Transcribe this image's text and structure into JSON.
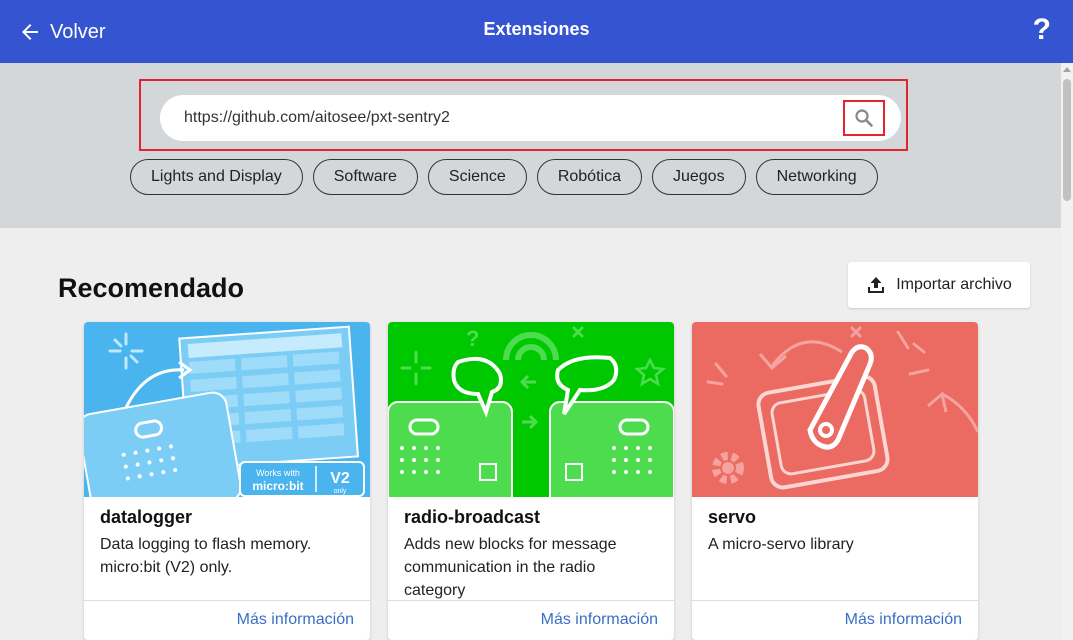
{
  "header": {
    "back_label": "Volver",
    "title": "Extensiones",
    "help_label": "?"
  },
  "search": {
    "value": "https://github.com/aitosee/pxt-sentry2"
  },
  "categories": [
    "Lights and Display",
    "Software",
    "Science",
    "Robótica",
    "Juegos",
    "Networking"
  ],
  "section": {
    "title": "Recomendado",
    "import_label": "Importar archivo"
  },
  "cards": [
    {
      "name": "datalogger",
      "description": "Data logging to flash memory. micro:bit (V2) only.",
      "link": "Más información",
      "badge_top": "Works with",
      "badge_brand": "micro:bit",
      "badge_v2": "V2",
      "badge_only": "only",
      "bg": "#4ab4ef"
    },
    {
      "name": "radio-broadcast",
      "description": "Adds new blocks for message communication in the radio category",
      "link": "Más información",
      "bg": "#00c800"
    },
    {
      "name": "servo",
      "description": "A micro-servo library",
      "link": "Más información",
      "bg": "#eb6a62"
    }
  ],
  "colors": {
    "header": "#3454d1",
    "highlight": "#e0252f",
    "link": "#3a6fc4"
  }
}
